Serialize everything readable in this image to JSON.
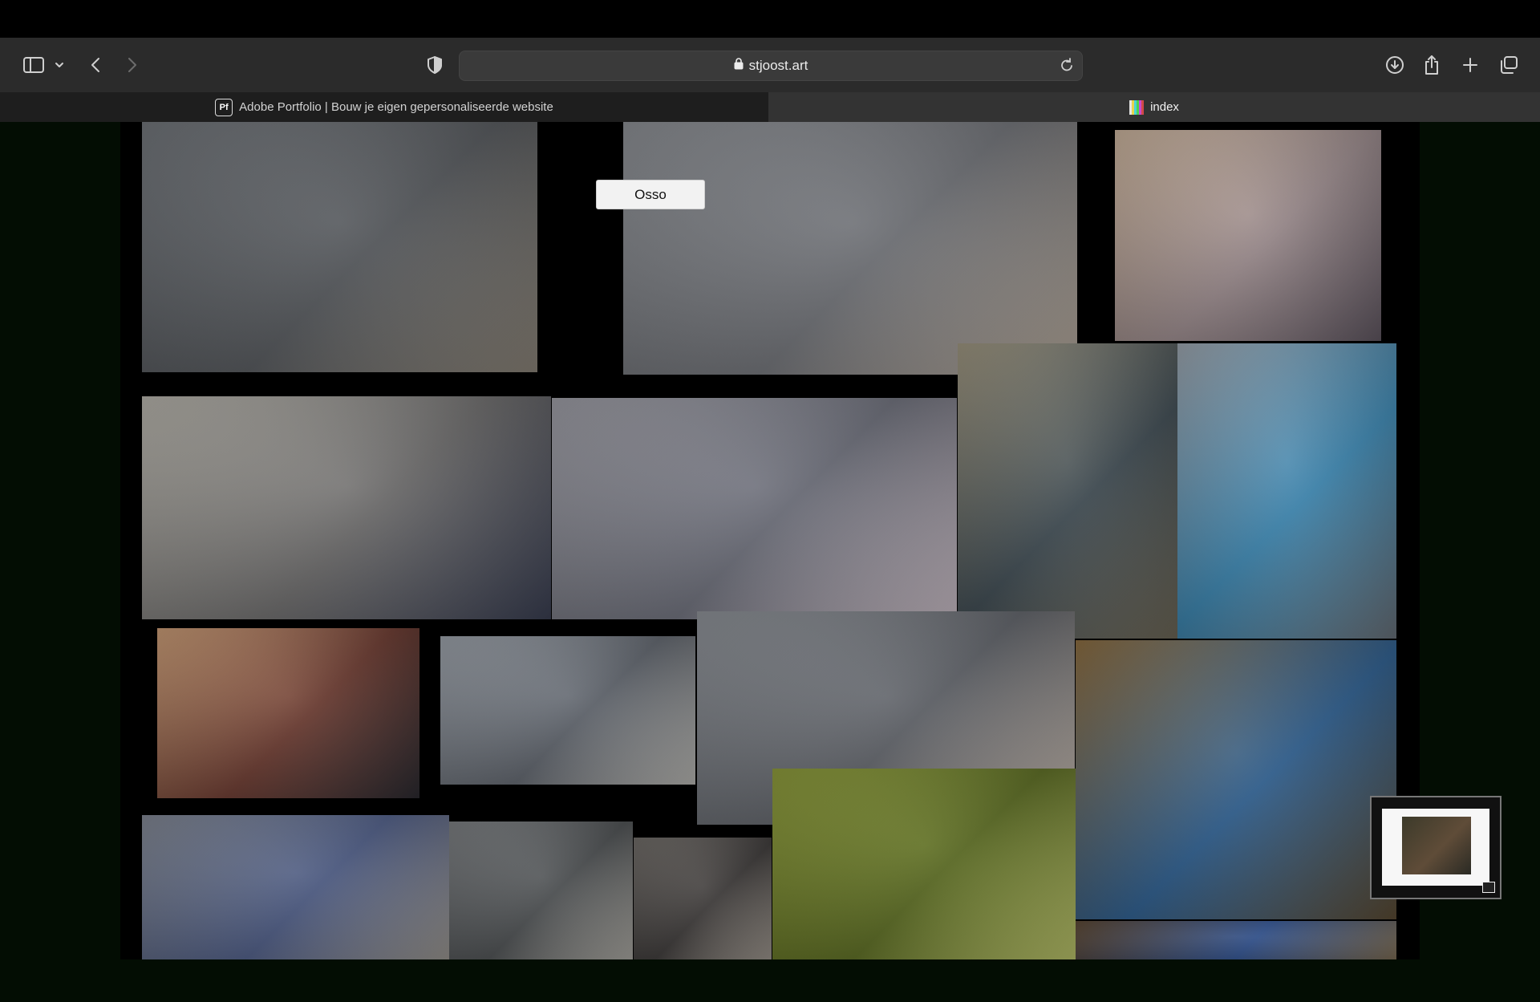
{
  "browser": {
    "url": "stjoost.art",
    "tabs": [
      {
        "label": "Adobe Portfolio | Bouw je eigen gepersonaliseerde website",
        "favicon": "Pf",
        "active": false
      },
      {
        "label": "index",
        "active": true
      }
    ]
  },
  "page": {
    "hover_label": "Osso",
    "photos": [
      {
        "name": "photo-man-tablet",
        "colors": [
          "#6f7378",
          "#54575b",
          "#8a8378"
        ]
      },
      {
        "name": "photo-woman-thinking",
        "colors": [
          "#8a8d92",
          "#6d6f74",
          "#b4a89b"
        ]
      },
      {
        "name": "photo-train-bridge",
        "colors": [
          "#c8b19a",
          "#9a8a8c",
          "#5f5660"
        ]
      },
      {
        "name": "photo-living-room-couple",
        "colors": [
          "#b5b2aa",
          "#6b6a6a",
          "#3a3f52"
        ]
      },
      {
        "name": "photo-woman-smiling",
        "colors": [
          "#9c9ca4",
          "#6a6c77",
          "#c9bdc6"
        ]
      },
      {
        "name": "photo-man-street-cafe",
        "colors": [
          "#9c947e",
          "#3f4b52",
          "#6c6656"
        ]
      },
      {
        "name": "photo-couple-walking",
        "colors": [
          "#9aa3ac",
          "#3d86b0",
          "#676f77"
        ]
      },
      {
        "name": "photo-street-night-lights",
        "colors": [
          "#c89a74",
          "#6a3a30",
          "#2b2a30"
        ]
      },
      {
        "name": "photo-man-profile",
        "colors": [
          "#9aa0a8",
          "#5e636b",
          "#b7b6b2"
        ]
      },
      {
        "name": "photo-woman-reading",
        "colors": [
          "#8c9096",
          "#5d6066",
          "#c4b8ad"
        ]
      },
      {
        "name": "photo-couple-cabin-sofa",
        "colors": [
          "#8a6b3e",
          "#2f5f8f",
          "#5a4a32"
        ]
      },
      {
        "name": "photo-bedroom-sleeping",
        "colors": [
          "#8c9a3a",
          "#5a6a22",
          "#b9c26a"
        ]
      },
      {
        "name": "photo-man-armchair",
        "colors": [
          "#7f8591",
          "#4c5a82",
          "#9a9690"
        ]
      },
      {
        "name": "photo-living-room-wide",
        "colors": [
          "#7a7d80",
          "#4d5052",
          "#a9a7a1"
        ]
      },
      {
        "name": "photo-woman-armchair",
        "colors": [
          "#6e6a66",
          "#3e3b3a",
          "#9b948c"
        ]
      },
      {
        "name": "photo-man-cabin-armchair",
        "colors": [
          "#5a4632",
          "#2f4f8a",
          "#7a6a52"
        ]
      }
    ]
  }
}
